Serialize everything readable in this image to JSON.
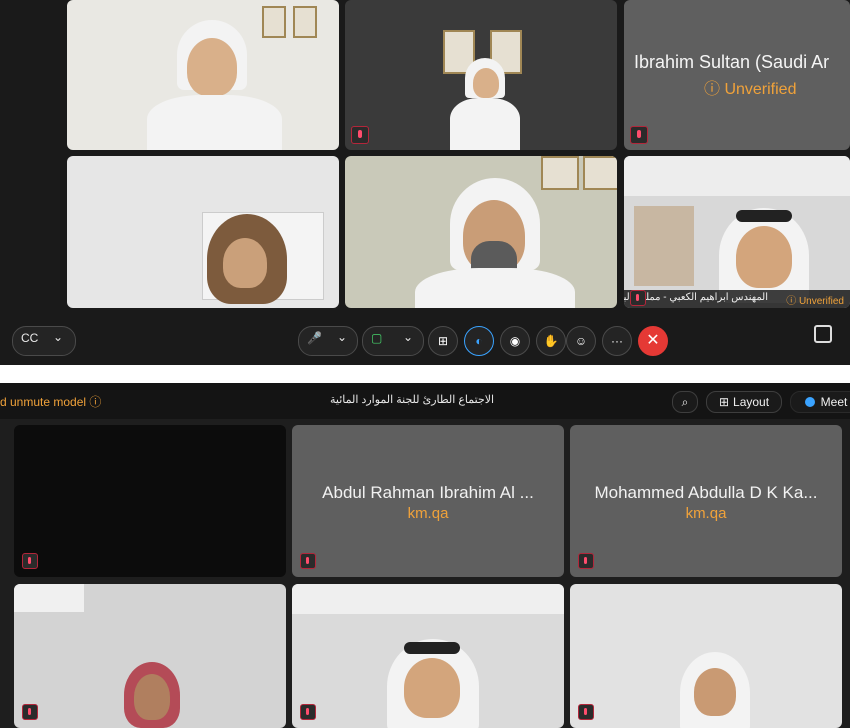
{
  "top_meeting": {
    "tiles": [
      {
        "label": ""
      },
      {
        "label": ""
      },
      {
        "label": "Ibrahim Sultan (Saudi Ar",
        "sub": "ⓘ Unverified"
      },
      {
        "label": ""
      },
      {
        "label": ""
      },
      {
        "label": "المهندس ابراهيم الكعبي - مملكة البحرين",
        "sub": "ⓘ Unverified"
      }
    ],
    "controls": {
      "cc": "CC",
      "more": "···",
      "leave": "✕"
    }
  },
  "bottom_meeting": {
    "header": {
      "left_text": "d unmute model ⓘ",
      "title": "الاجتماع الطارئ للجنة الموارد المائية",
      "layout_label": "Layout",
      "meet_label": "Meet"
    },
    "tiles": [
      {
        "name": "",
        "sub": ""
      },
      {
        "name": "Abdul Rahman Ibrahim Al ...",
        "sub": "km.qa"
      },
      {
        "name": "Mohammed Abdulla D K Ka...",
        "sub": "km.qa"
      },
      {
        "name": "",
        "sub": ""
      },
      {
        "name": "",
        "sub": ""
      },
      {
        "name": "",
        "sub": ""
      }
    ]
  },
  "colors": {
    "accent": "#f0a23a",
    "danger": "#e53935",
    "tile_gray": "#5f5f5f"
  }
}
